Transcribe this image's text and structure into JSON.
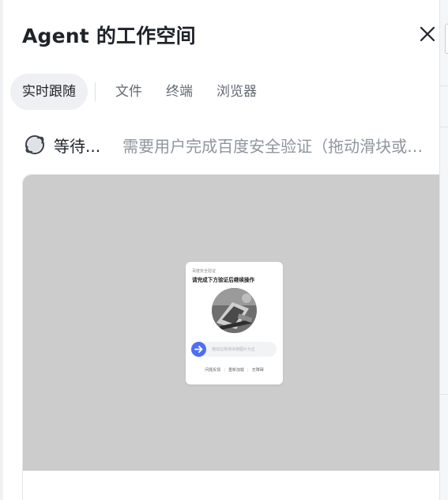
{
  "header": {
    "title": "Agent 的工作空间",
    "close_icon": "close-icon"
  },
  "tabs": [
    {
      "label": "实时跟随",
      "active": true
    },
    {
      "label": "文件",
      "active": false
    },
    {
      "label": "终端",
      "active": false
    },
    {
      "label": "浏览器",
      "active": false
    }
  ],
  "status": {
    "icon": "planet-icon",
    "label": "等待...",
    "description": "需要用户完成百度安全验证（拖动滑块或…"
  },
  "browser": {
    "captcha": {
      "small_title": "百度安全验证",
      "main_title": "请完成下方验证后继续操作",
      "slider_hint": "拖动左侧滑块使图片为正",
      "links": [
        "问题反馈",
        "重新加载",
        "无障碍"
      ]
    }
  },
  "colors": {
    "accent": "#4e6ef2",
    "screen_bg": "#cccccc",
    "tab_active_bg": "#eef0f4"
  }
}
